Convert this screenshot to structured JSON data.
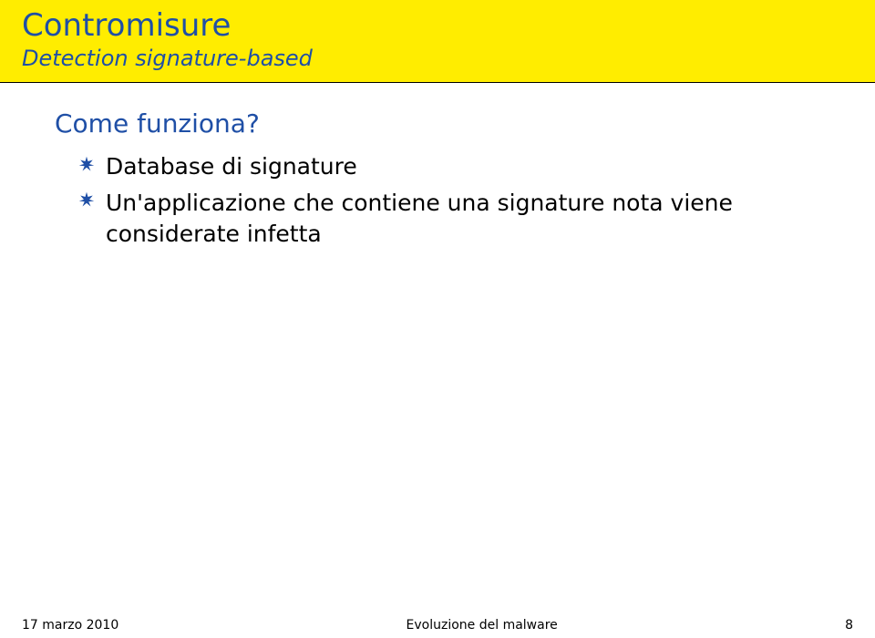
{
  "header": {
    "title": "Contromisure",
    "subtitle": "Detection signature-based"
  },
  "content": {
    "section_heading": "Come funziona?",
    "bullets": [
      "Database di signature",
      "Un'applicazione che contiene una signature nota viene considerate infetta"
    ]
  },
  "footer": {
    "date": "17 marzo 2010",
    "center": "Evoluzione del malware",
    "page": "8"
  },
  "icons": {
    "bullet_name": "starburst-icon"
  }
}
